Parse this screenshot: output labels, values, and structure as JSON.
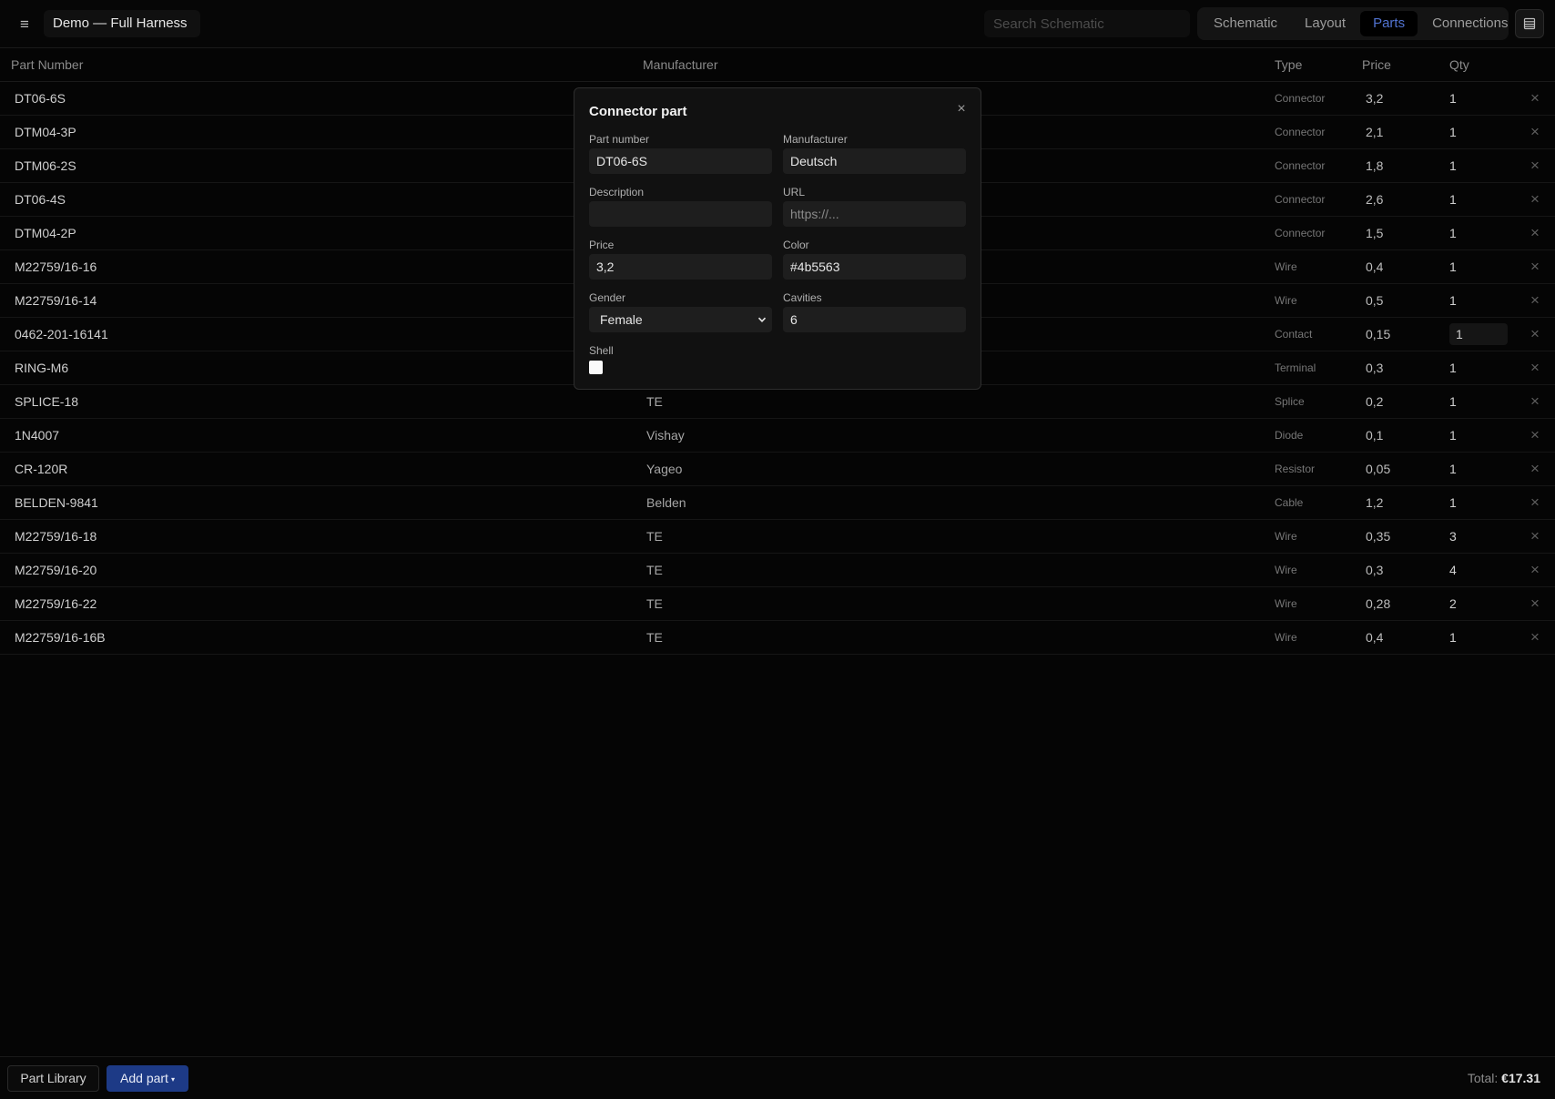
{
  "topbar": {
    "menu_icon": "≡",
    "doc_title": "Demo — Full Harness",
    "search_placeholder": "Search Schematic",
    "tabs": [
      {
        "label": "Schematic",
        "active": false
      },
      {
        "label": "Layout",
        "active": false
      },
      {
        "label": "Parts",
        "active": true
      },
      {
        "label": "Connections",
        "active": false
      }
    ],
    "panel_icon": "table-panel-icon",
    "accent_color": "#5173d0"
  },
  "table": {
    "headers": {
      "part_number": "Part Number",
      "manufacturer": "Manufacturer",
      "type": "Type",
      "price": "Price",
      "qty": "Qty"
    },
    "delete_glyph": "×",
    "rows": [
      {
        "part": "DT06-6S",
        "manufacturer": "",
        "type": "Connector",
        "price": "3,2",
        "qty": "1"
      },
      {
        "part": "DTM04-3P",
        "manufacturer": "",
        "type": "Connector",
        "price": "2,1",
        "qty": "1"
      },
      {
        "part": "DTM06-2S",
        "manufacturer": "",
        "type": "Connector",
        "price": "1,8",
        "qty": "1"
      },
      {
        "part": "DT06-4S",
        "manufacturer": "",
        "type": "Connector",
        "price": "2,6",
        "qty": "1"
      },
      {
        "part": "DTM04-2P",
        "manufacturer": "",
        "type": "Connector",
        "price": "1,5",
        "qty": "1"
      },
      {
        "part": "M22759/16-16",
        "manufacturer": "",
        "type": "Wire",
        "price": "0,4",
        "qty": "1"
      },
      {
        "part": "M22759/16-14",
        "manufacturer": "",
        "type": "Wire",
        "price": "0,5",
        "qty": "1"
      },
      {
        "part": "0462-201-16141",
        "manufacturer": "",
        "type": "Contact",
        "price": "0,15",
        "qty": "1",
        "editing": true
      },
      {
        "part": "RING-M6",
        "manufacturer": "",
        "type": "Terminal",
        "price": "0,3",
        "qty": "1"
      },
      {
        "part": "SPLICE-18",
        "manufacturer": "TE",
        "type": "Splice",
        "price": "0,2",
        "qty": "1"
      },
      {
        "part": "1N4007",
        "manufacturer": "Vishay",
        "type": "Diode",
        "price": "0,1",
        "qty": "1"
      },
      {
        "part": "CR-120R",
        "manufacturer": "Yageo",
        "type": "Resistor",
        "price": "0,05",
        "qty": "1"
      },
      {
        "part": "BELDEN-9841",
        "manufacturer": "Belden",
        "type": "Cable",
        "price": "1,2",
        "qty": "1"
      },
      {
        "part": "M22759/16-18",
        "manufacturer": "TE",
        "type": "Wire",
        "price": "0,35",
        "qty": "3"
      },
      {
        "part": "M22759/16-20",
        "manufacturer": "TE",
        "type": "Wire",
        "price": "0,3",
        "qty": "4"
      },
      {
        "part": "M22759/16-22",
        "manufacturer": "TE",
        "type": "Wire",
        "price": "0,28",
        "qty": "2"
      },
      {
        "part": "M22759/16-16B",
        "manufacturer": "TE",
        "type": "Wire",
        "price": "0,4",
        "qty": "1"
      }
    ]
  },
  "modal": {
    "title": "Connector part",
    "close_glyph": "×",
    "fields": {
      "part_number": {
        "label": "Part number",
        "value": "DT06-6S"
      },
      "manufacturer": {
        "label": "Manufacturer",
        "value": "Deutsch"
      },
      "description": {
        "label": "Description",
        "value": "",
        "placeholder": ""
      },
      "url": {
        "label": "URL",
        "value": "",
        "placeholder": "https://..."
      },
      "price": {
        "label": "Price",
        "value": "3,2"
      },
      "color": {
        "label": "Color",
        "value": "#4b5563"
      },
      "gender": {
        "label": "Gender",
        "value": "Female"
      },
      "cavities": {
        "label": "Cavities",
        "value": "6"
      },
      "shell": {
        "label": "Shell",
        "checked": false
      }
    }
  },
  "bottombar": {
    "library_label": "Part Library",
    "add_label": "Add part",
    "add_caret": "▾",
    "add_color": "#1d3a86",
    "total_label": "Total:",
    "total_value": "€17.31"
  }
}
